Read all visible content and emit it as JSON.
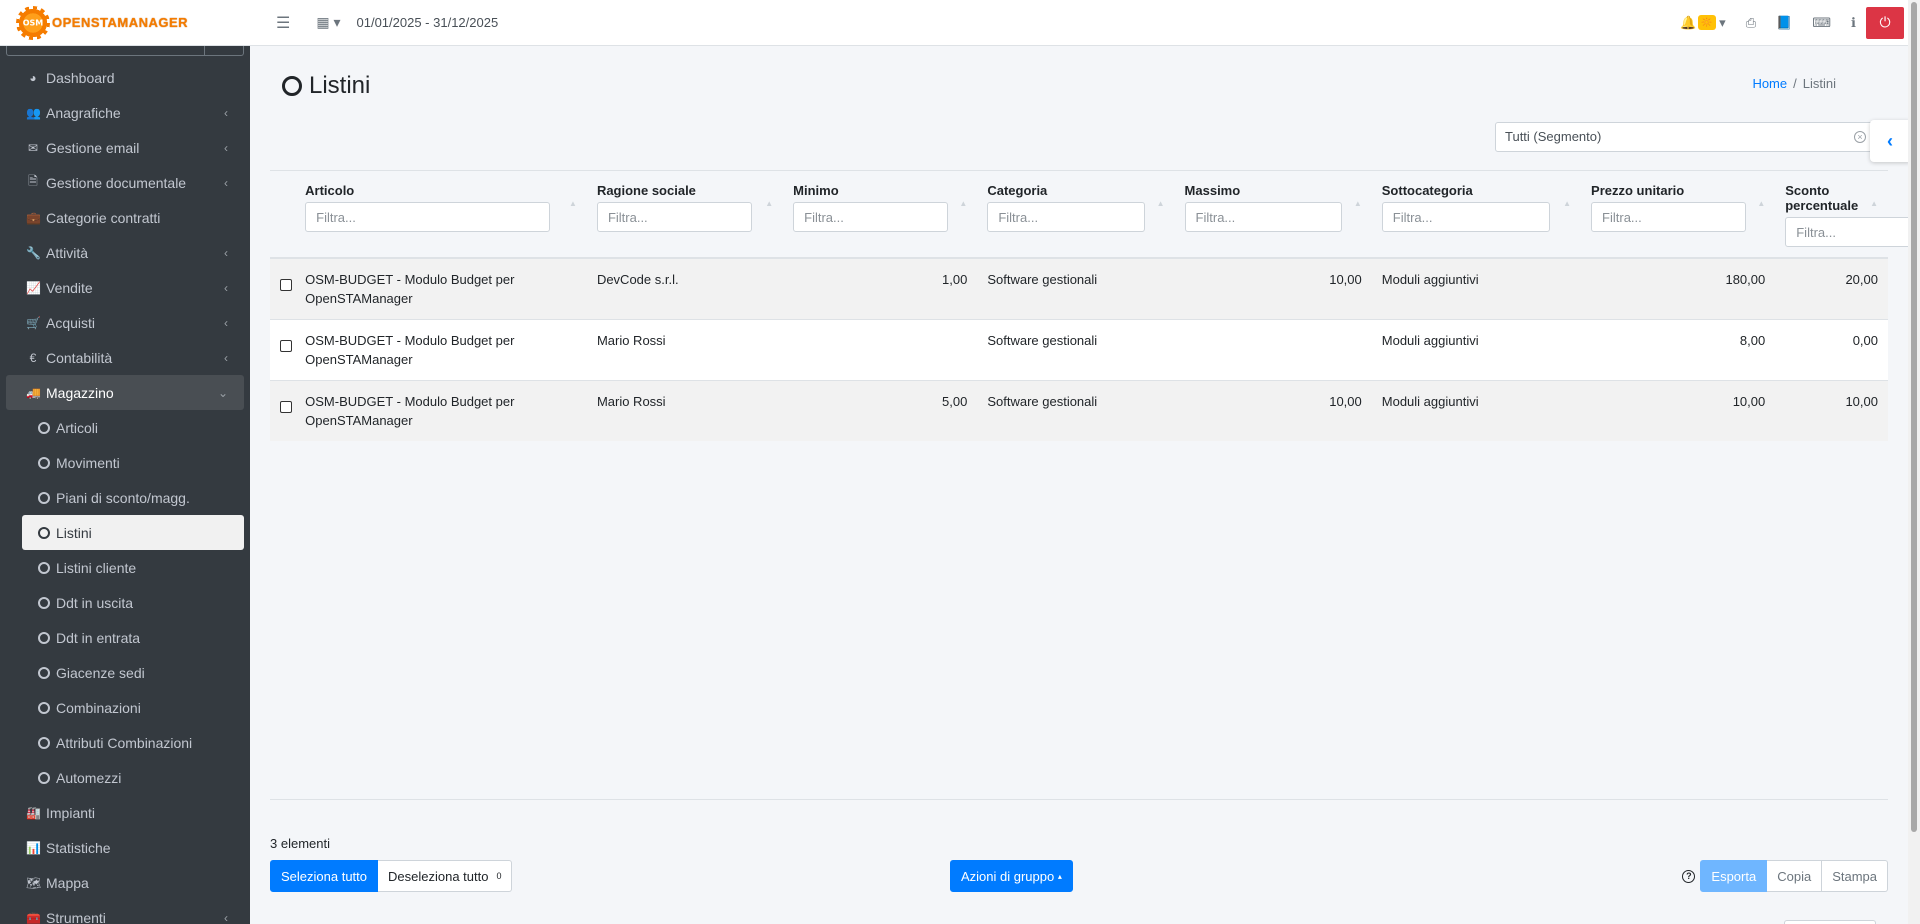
{
  "brand": {
    "logo_text": "OSM",
    "name": "OPENSTAMANAGER"
  },
  "sidebar": {
    "items": [
      {
        "icon": "dashboard-icon",
        "glyph": "◕",
        "label": "Dashboard",
        "chevron": false
      },
      {
        "icon": "users-icon",
        "glyph": "👥",
        "label": "Anagrafiche",
        "chevron": true
      },
      {
        "icon": "envelope-icon",
        "glyph": "✉",
        "label": "Gestione email",
        "chevron": true
      },
      {
        "icon": "file-icon",
        "glyph": "🗎",
        "label": "Gestione documentale",
        "chevron": true
      },
      {
        "icon": "briefcase-icon",
        "glyph": "💼",
        "label": "Categorie contratti",
        "chevron": false
      },
      {
        "icon": "wrench-icon",
        "glyph": "🔧",
        "label": "Attività",
        "chevron": true
      },
      {
        "icon": "chart-line-icon",
        "glyph": "📈",
        "label": "Vendite",
        "chevron": true
      },
      {
        "icon": "cart-icon",
        "glyph": "🛒",
        "label": "Acquisti",
        "chevron": true
      },
      {
        "icon": "euro-icon",
        "glyph": "€",
        "label": "Contabilità",
        "chevron": true
      },
      {
        "icon": "truck-icon",
        "glyph": "🚚",
        "label": "Magazzino",
        "chevron": true,
        "active": true,
        "expanded": true
      }
    ],
    "submenu": [
      {
        "label": "Articoli"
      },
      {
        "label": "Movimenti"
      },
      {
        "label": "Piani di sconto/magg."
      },
      {
        "label": "Listini",
        "active": true
      },
      {
        "label": "Listini cliente"
      },
      {
        "label": "Ddt in uscita"
      },
      {
        "label": "Ddt in entrata"
      },
      {
        "label": "Giacenze sedi"
      },
      {
        "label": "Combinazioni"
      },
      {
        "label": "Attributi Combinazioni"
      },
      {
        "label": "Automezzi"
      }
    ],
    "items_after": [
      {
        "icon": "building-icon",
        "glyph": "🏭",
        "label": "Impianti",
        "chevron": false
      },
      {
        "icon": "bar-chart-icon",
        "glyph": "📊",
        "label": "Statistiche",
        "chevron": false
      },
      {
        "icon": "map-icon",
        "glyph": "🗺",
        "label": "Mappa",
        "chevron": false
      },
      {
        "icon": "tools-icon",
        "glyph": "🧰",
        "label": "Strumenti",
        "chevron": true
      }
    ]
  },
  "topbar": {
    "date_range": "01/01/2025 - 31/12/2025",
    "notification_badge": "🔆"
  },
  "page": {
    "title": "Listini",
    "breadcrumb_home": "Home",
    "breadcrumb_sep": "/",
    "breadcrumb_current": "Listini",
    "segment_value": "Tutti (Segmento)"
  },
  "table": {
    "filter_placeholder": "Filtra...",
    "columns": [
      {
        "label": "Articolo",
        "width": 290,
        "input": 245
      },
      {
        "label": "Ragione sociale",
        "width": 195,
        "input": 155
      },
      {
        "label": "Minimo",
        "width": 193,
        "input": 155
      },
      {
        "label": "Categoria",
        "width": 196,
        "input": 158
      },
      {
        "label": "Massimo",
        "width": 196,
        "input": 157
      },
      {
        "label": "Sottocategoria",
        "width": 208,
        "input": 168
      },
      {
        "label": "Prezzo unitario",
        "width": 193,
        "input": 155
      },
      {
        "label": "Sconto percentuale",
        "width": 112,
        "input": 160
      }
    ],
    "rows": [
      [
        "OSM-BUDGET - Modulo Budget per OpenSTAManager",
        "DevCode s.r.l.",
        "1,00",
        "Software gestionali",
        "10,00",
        "Moduli aggiuntivi",
        "180,00",
        "20,00"
      ],
      [
        "OSM-BUDGET - Modulo Budget per OpenSTAManager",
        "Mario Rossi",
        "",
        "Software gestionali",
        "",
        "Moduli aggiuntivi",
        "8,00",
        "0,00"
      ],
      [
        "OSM-BUDGET - Modulo Budget per OpenSTAManager",
        "Mario Rossi",
        "5,00",
        "Software gestionali",
        "10,00",
        "Moduli aggiuntivi",
        "10,00",
        "10,00"
      ]
    ]
  },
  "footer": {
    "count_text": "3 elementi",
    "select_all": "Seleziona tutto",
    "deselect_all": "Deseleziona tutto",
    "selected_count": "0",
    "group_actions": "Azioni di gruppo",
    "export": "Esporta",
    "copy": "Copia",
    "print": "Stampa"
  },
  "colors": {
    "primary": "#007bff",
    "sidebar_bg": "#343a40",
    "danger": "#dc3545",
    "brand": "#f57c00"
  }
}
